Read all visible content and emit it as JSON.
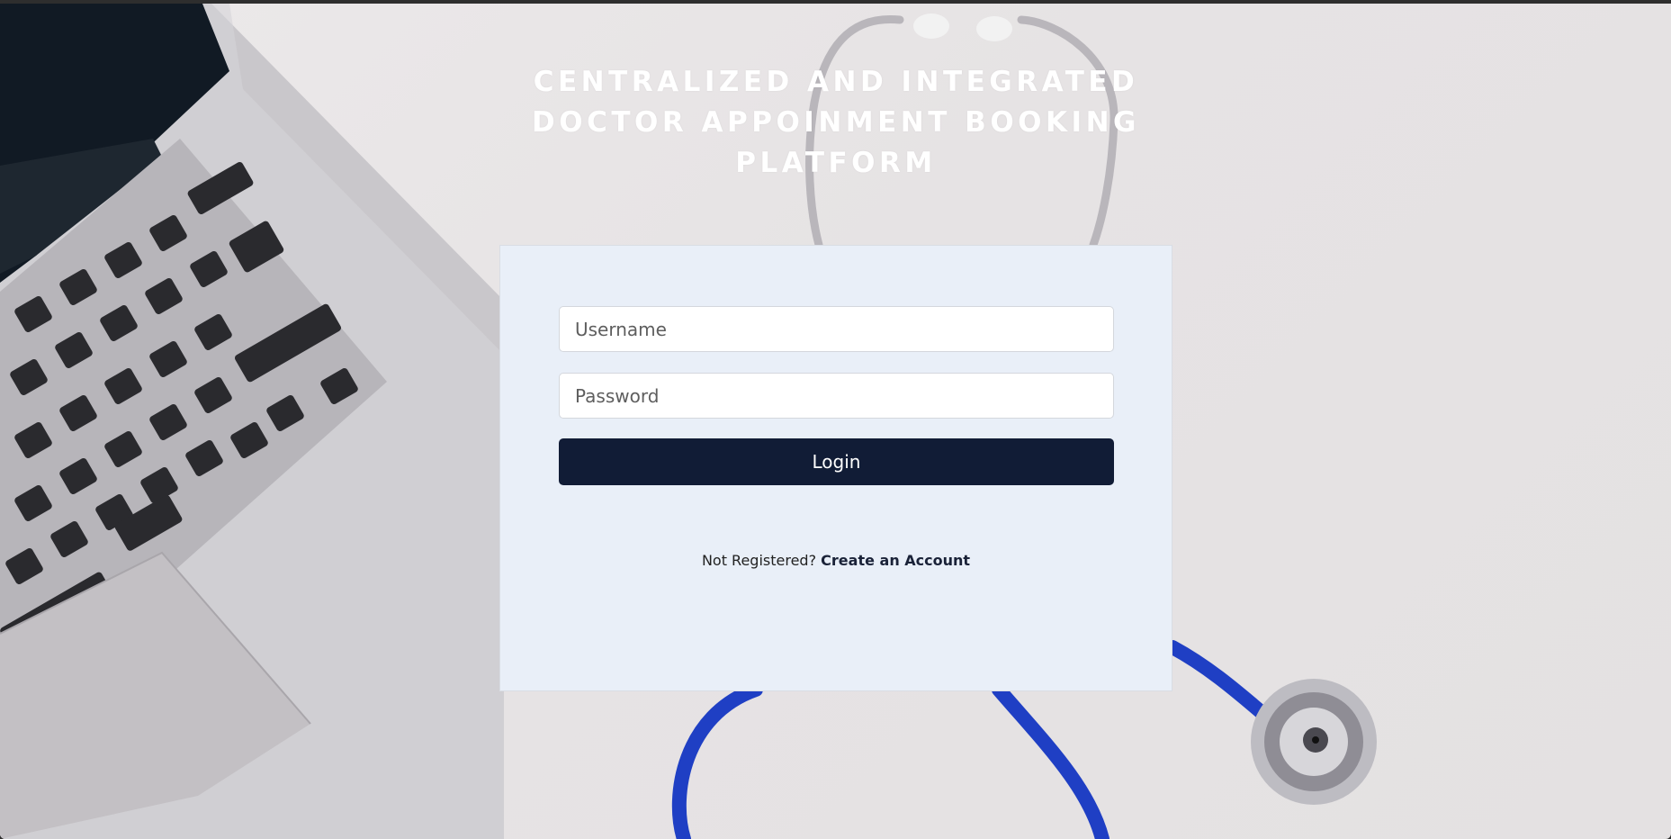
{
  "title": {
    "line1": "CENTRALIZED AND INTEGRATED",
    "line2": "DOCTOR APPOINMENT BOOKING",
    "line3": "PLATFORM"
  },
  "login_form": {
    "username_placeholder": "Username",
    "password_placeholder": "Password",
    "login_label": "Login",
    "register_prompt": "Not Registered?",
    "register_link": "Create an Account"
  },
  "colors": {
    "card_background": "#e9eff8",
    "button_background": "#111c36",
    "stethoscope_blue": "#1f3fc4"
  }
}
